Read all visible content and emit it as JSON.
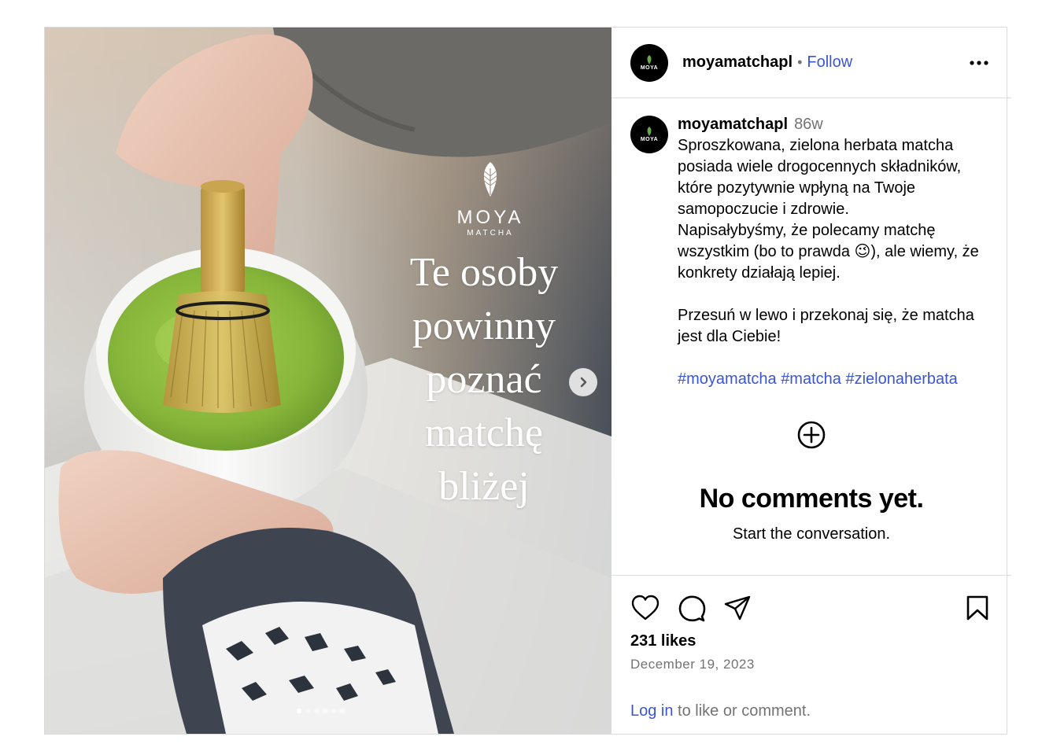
{
  "media": {
    "brand_name": "MOYA",
    "brand_sub": "MATCHA",
    "headline": [
      "Te osoby",
      "powinny",
      "poznać",
      "matchę",
      "bliżej"
    ],
    "carousel_dot_count": 6,
    "active_dot_index": 0
  },
  "header": {
    "avatar_text": "MOYA",
    "username": "moyamatchapl",
    "separator": "•",
    "follow_label": "Follow"
  },
  "caption": {
    "avatar_text": "MOYA",
    "username": "moyamatchapl",
    "time": "86w",
    "text": "Sproszkowana, zielona herbata matcha posiada wiele drogocennych składników, które pozytywnie wpłyną na Twoje samopoczucie i zdrowie.\nNapisałybyśmy, że polecamy matchę wszystkim (bo to prawda 😉), ale wiemy, że konkrety działają lepiej.\n\nPrzesuń w lewo i przekonaj się, że matcha jest dla Ciebie!\n\n",
    "hashtags": [
      "#moyamatcha",
      "#matcha",
      "#zielonaherbata"
    ]
  },
  "comments": {
    "empty_title": "No comments yet.",
    "empty_subtitle": "Start the conversation."
  },
  "actions": {
    "icons": [
      "heart-icon",
      "comment-icon",
      "share-icon",
      "bookmark-icon"
    ]
  },
  "stats": {
    "likes": "231 likes",
    "date": "December 19, 2023"
  },
  "footer": {
    "login_link": "Log in",
    "login_rest": " to like or comment."
  },
  "colors": {
    "link": "#3a55d6",
    "muted": "#737373",
    "border": "#dbdbdb",
    "matcha_green": "#8fbf3a"
  }
}
